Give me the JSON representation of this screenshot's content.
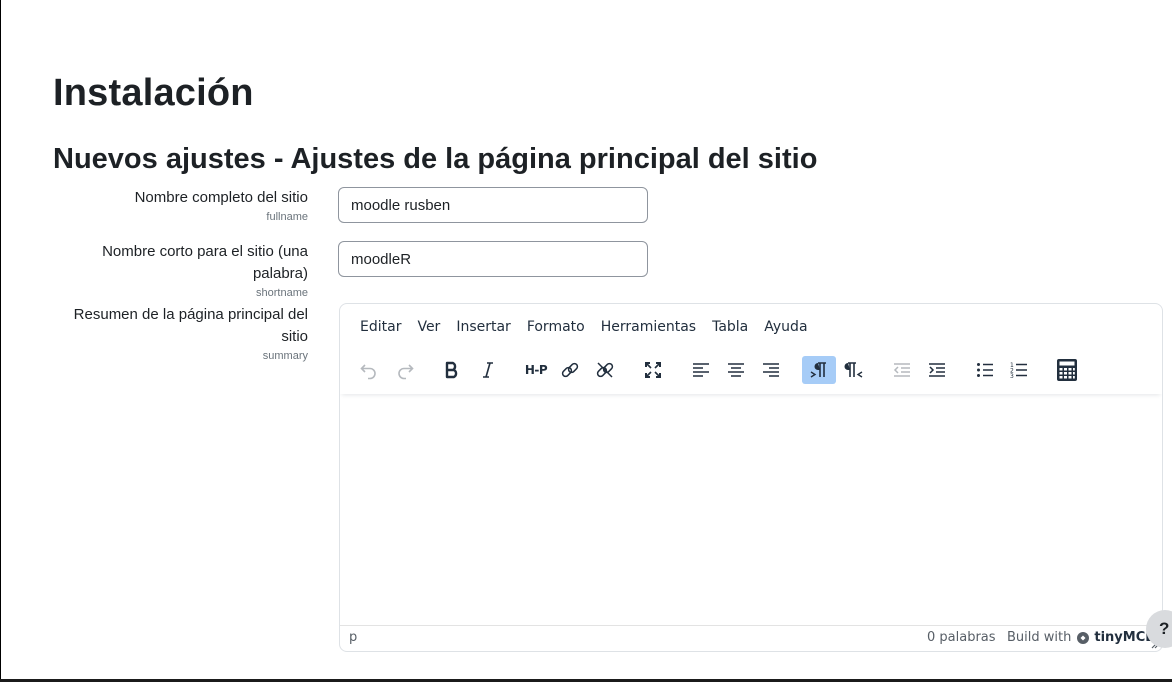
{
  "page": {
    "title": "Instalación",
    "section_title": "Nuevos ajustes - Ajustes de la página principal del sitio"
  },
  "fields": {
    "fullname": {
      "label": "Nombre completo del sitio",
      "name": "fullname",
      "value": "moodle rusben"
    },
    "shortname": {
      "label": "Nombre corto para el sitio (una palabra)",
      "name": "shortname",
      "value": "moodleR"
    },
    "summary": {
      "label": "Resumen de la página principal del sitio",
      "name": "summary"
    }
  },
  "editor": {
    "menu": [
      "Editar",
      "Ver",
      "Insertar",
      "Formato",
      "Herramientas",
      "Tabla",
      "Ayuda"
    ],
    "toolbar_icons": [
      "undo-icon",
      "redo-icon",
      "bold-icon",
      "italic-icon",
      "h5p-icon",
      "link-icon",
      "unlink-icon",
      "fullscreen-icon",
      "align-left-icon",
      "align-center-icon",
      "align-right-icon",
      "ltr-icon",
      "rtl-icon",
      "outdent-icon",
      "indent-icon",
      "bullet-list-icon",
      "numbered-list-icon",
      "calculator-icon"
    ],
    "h5p_label": "H-P",
    "active_button": "ltr-icon",
    "active_color": "#a6ccf7",
    "status_path": "p",
    "word_count": "0 palabras",
    "build_with": "Build with",
    "brand": "tinyMCE"
  },
  "help_button_label": "?"
}
